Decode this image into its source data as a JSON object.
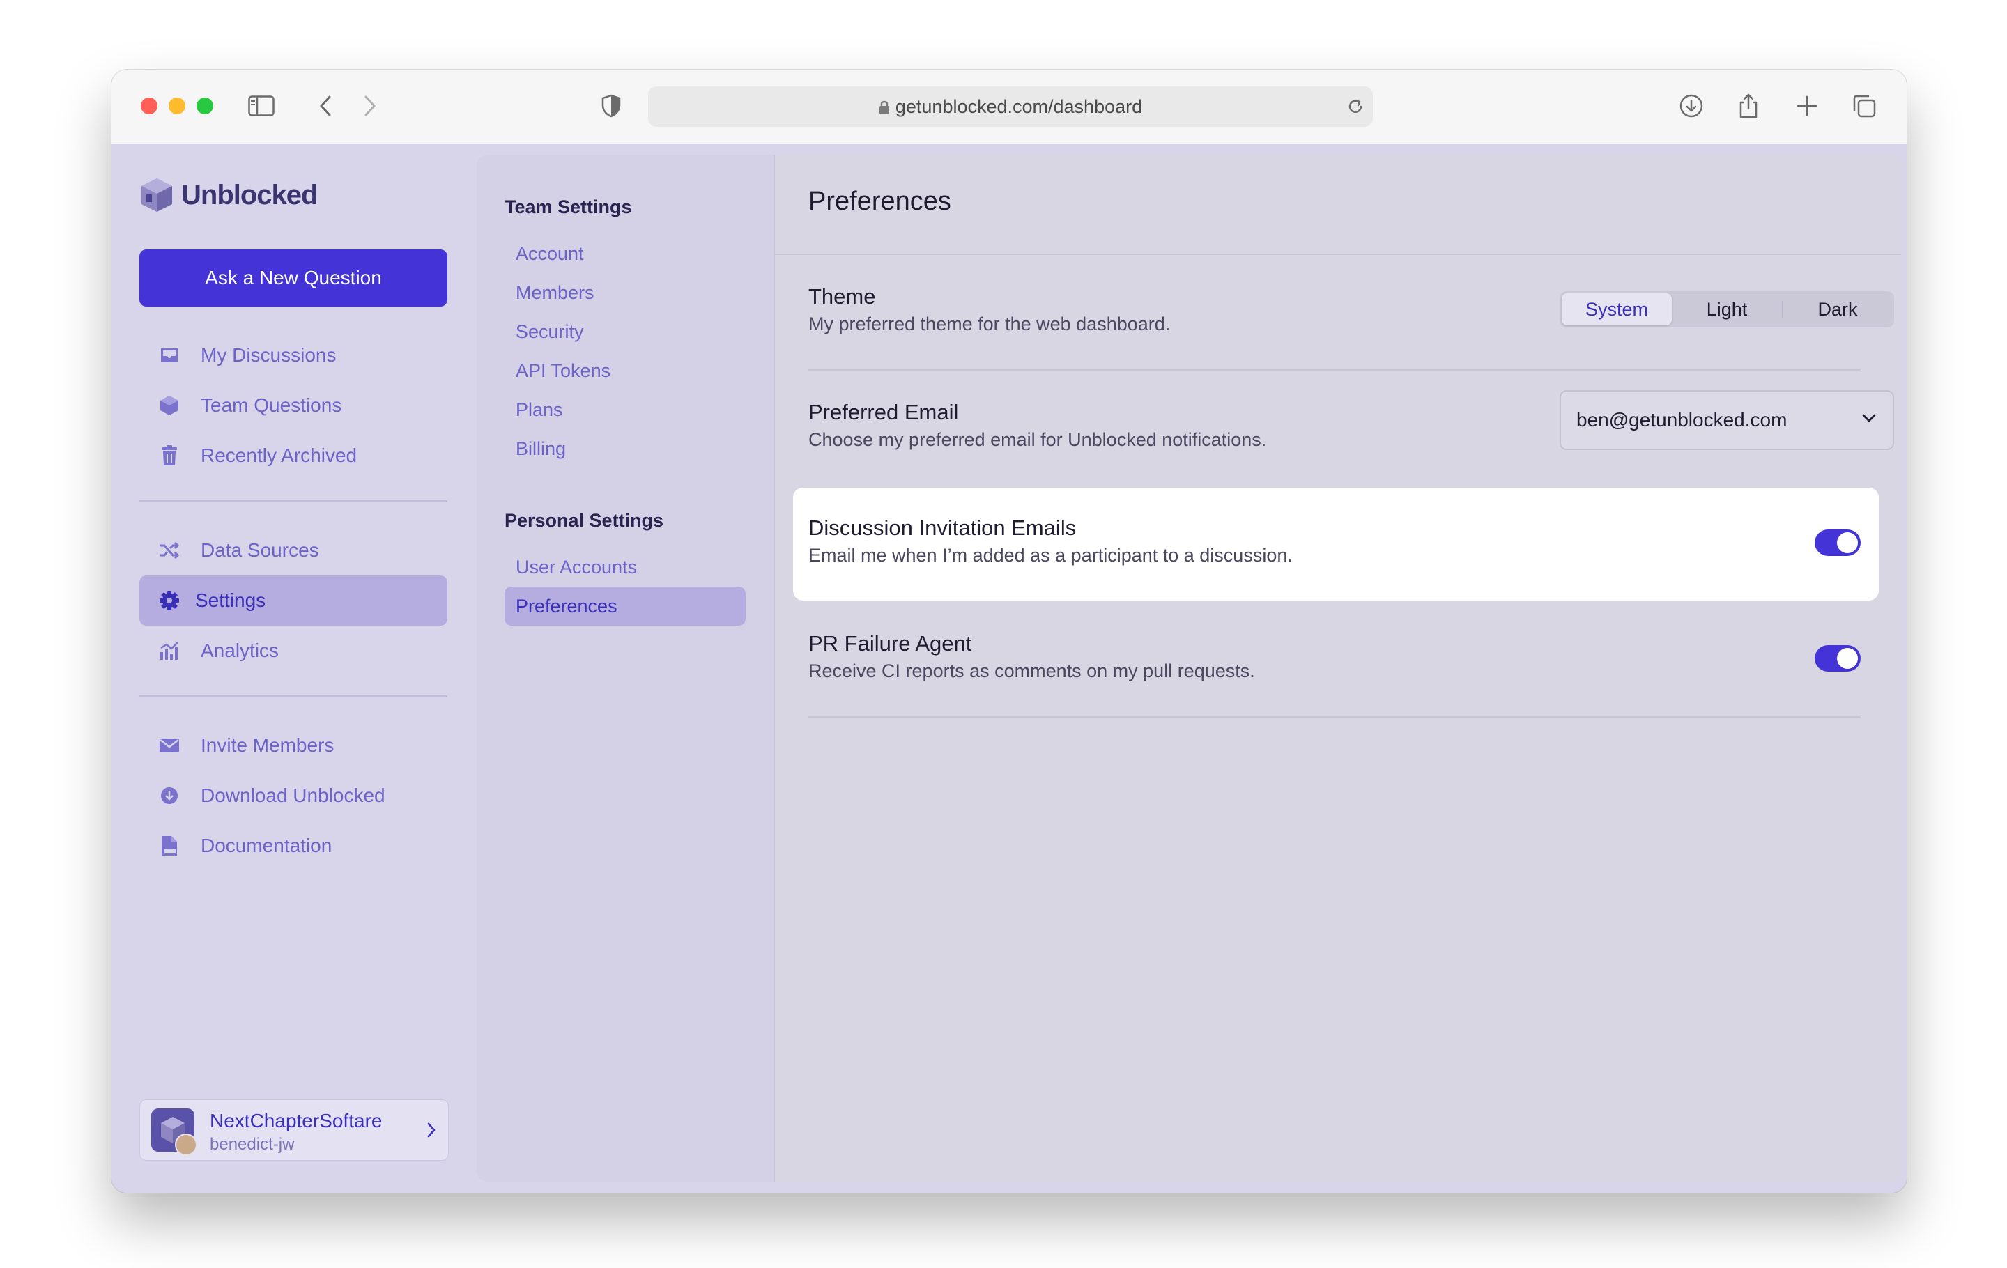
{
  "browser": {
    "url": "getunblocked.com/dashboard"
  },
  "sidebar": {
    "logo_text": "Unblocked",
    "ask_button": "Ask a New Question",
    "items_group1": [
      {
        "label": "My Discussions",
        "icon": "inbox-icon"
      },
      {
        "label": "Team Questions",
        "icon": "cube-icon"
      },
      {
        "label": "Recently Archived",
        "icon": "trash-icon"
      }
    ],
    "items_group2": [
      {
        "label": "Data Sources",
        "icon": "shuffle-icon"
      },
      {
        "label": "Settings",
        "icon": "gear-icon",
        "active": true
      },
      {
        "label": "Analytics",
        "icon": "chart-icon"
      }
    ],
    "items_group3": [
      {
        "label": "Invite Members",
        "icon": "mail-icon"
      },
      {
        "label": "Download Unblocked",
        "icon": "download-icon"
      },
      {
        "label": "Documentation",
        "icon": "doc-icon"
      }
    ],
    "workspace": {
      "name": "NextChapterSoftare",
      "user": "benedict-jw"
    }
  },
  "settings_nav": {
    "team_header": "Team Settings",
    "team_items": [
      "Account",
      "Members",
      "Security",
      "API Tokens",
      "Plans",
      "Billing"
    ],
    "personal_header": "Personal Settings",
    "personal_items": [
      "User Accounts",
      "Preferences"
    ],
    "active": "Preferences"
  },
  "main": {
    "title": "Preferences",
    "theme": {
      "title": "Theme",
      "description": "My preferred theme for the web dashboard.",
      "options": [
        "System",
        "Light",
        "Dark"
      ],
      "selected": "System"
    },
    "email": {
      "title": "Preferred Email",
      "description": "Choose my preferred email for Unblocked notifications.",
      "value": "ben@getunblocked.com"
    },
    "invitation": {
      "title": "Discussion Invitation Emails",
      "description": "Email me when I’m added as a participant to a discussion.",
      "enabled": true
    },
    "pr_agent": {
      "title": "PR Failure Agent",
      "description": "Receive CI reports as comments on my pull requests.",
      "enabled": true
    }
  },
  "colors": {
    "accent": "#4434d8",
    "nav_text": "#6c63c8",
    "active_bg": "#b5ade0"
  }
}
